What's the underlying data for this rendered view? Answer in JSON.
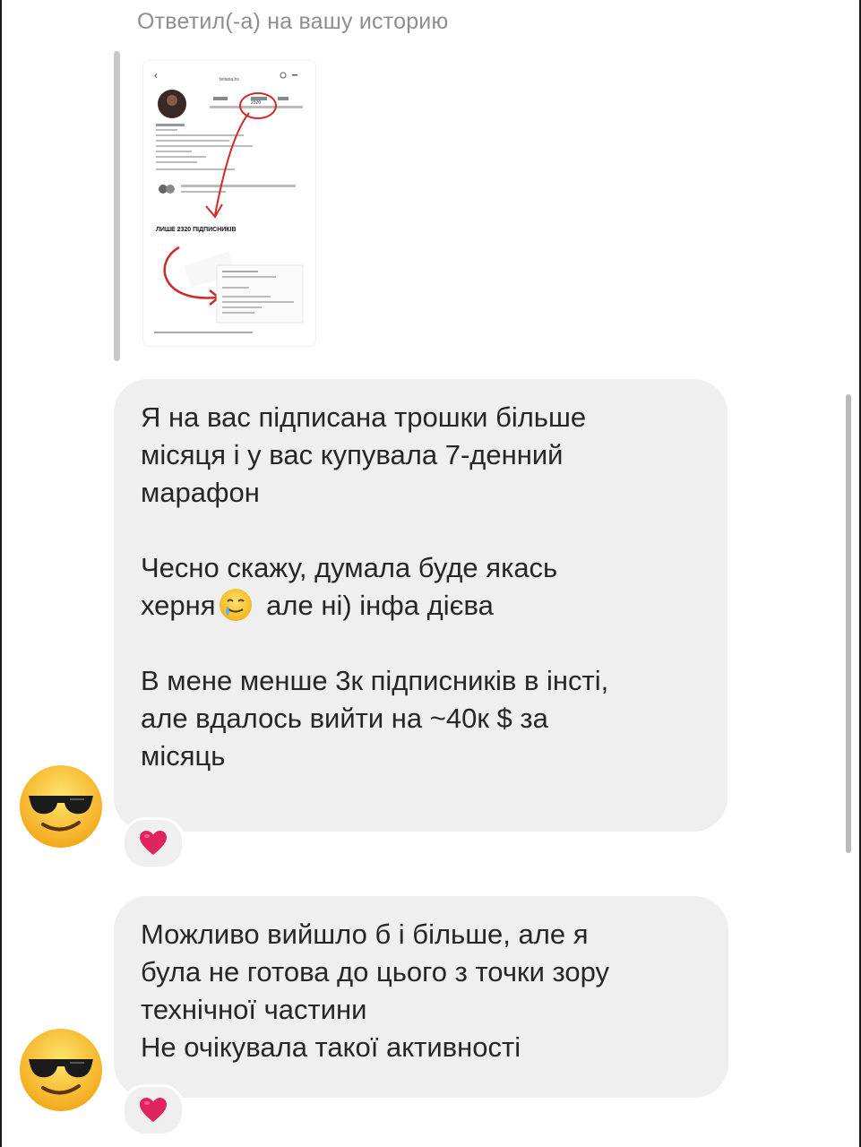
{
  "reply_header": {
    "label": "Ответил(-а) на вашу историю"
  },
  "story_preview": {
    "username": "tetiana.hs",
    "followers_count": "2320",
    "headline": "ЛИШЕ 2320 ПІДПИСНИКІВ",
    "accent_color": "#d22a2a"
  },
  "messages": [
    {
      "paragraphs": [
        "Я на вас підписана трошки більше\nмісяця і у вас купувала 7-денний\nмарафон",
        "Чесно скажу, думала буде якась\nхерня",
        "В мене менше 3к підписників в інсті,\nале вдалось вийти на ~40к $ за\nмісяць"
      ],
      "paragraph2_tail": " але ні) інфа дієва",
      "inline_emoji": "crying-smile-emoji",
      "sender_avatar": "sunglasses-emoji",
      "reaction": "heart"
    },
    {
      "paragraphs": [
        "Можливо вийшло б і більше, але я\nбула не готова до цього з точки зору\nтехнічної частини\nНе очікувала такої активності"
      ],
      "sender_avatar": "sunglasses-emoji",
      "reaction": "heart"
    }
  ],
  "colors": {
    "bubble_bg": "#efefef",
    "reply_line": "#c8c8c8",
    "reaction_heart": "#e0245e"
  }
}
